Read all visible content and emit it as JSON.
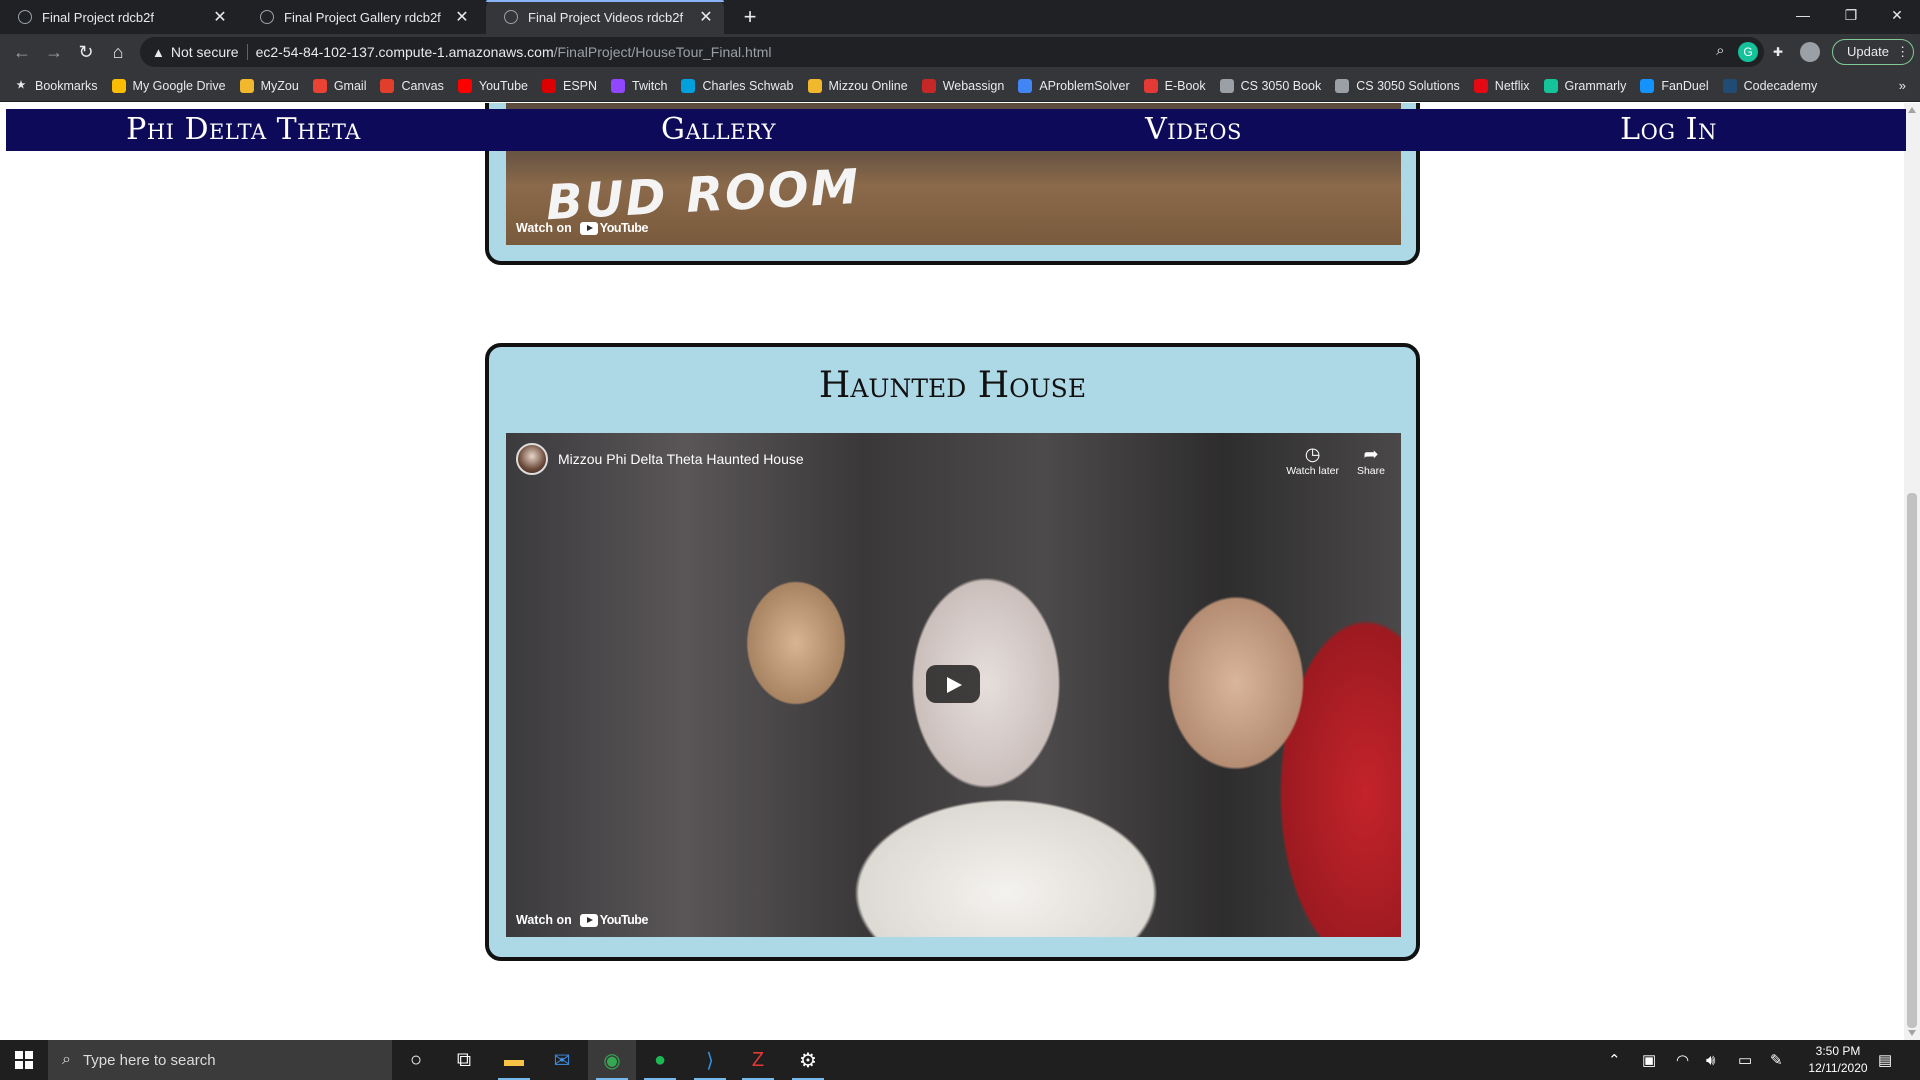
{
  "browser": {
    "tabs": [
      {
        "title": "Final Project rdcb2f",
        "active": false
      },
      {
        "title": "Final Project Gallery rdcb2f",
        "active": false
      },
      {
        "title": "Final Project Videos rdcb2f",
        "active": true
      }
    ],
    "security_label": "Not secure",
    "url_host": "ec2-54-84-102-137.compute-1.amazonaws.com",
    "url_path": "/FinalProject/HouseTour_Final.html",
    "update_label": "Update",
    "bookmarks": [
      {
        "label": "Bookmarks",
        "icon": "star-icon",
        "color": "#e8eaed"
      },
      {
        "label": "My Google Drive",
        "icon": "drive-icon",
        "color": "#fbbc04"
      },
      {
        "label": "MyZou",
        "icon": "myzou-icon",
        "color": "#f1b82d"
      },
      {
        "label": "Gmail",
        "icon": "gmail-icon",
        "color": "#ea4335"
      },
      {
        "label": "Canvas",
        "icon": "canvas-icon",
        "color": "#e13f2b"
      },
      {
        "label": "YouTube",
        "icon": "youtube-icon",
        "color": "#ff0000"
      },
      {
        "label": "ESPN",
        "icon": "espn-icon",
        "color": "#d00"
      },
      {
        "label": "Twitch",
        "icon": "twitch-icon",
        "color": "#9146ff"
      },
      {
        "label": "Charles Schwab",
        "icon": "schwab-icon",
        "color": "#00a0df"
      },
      {
        "label": "Mizzou Online",
        "icon": "mizzou-icon",
        "color": "#f1b82d"
      },
      {
        "label": "Webassign",
        "icon": "webassign-icon",
        "color": "#c62828"
      },
      {
        "label": "AProblemSolver",
        "icon": "aproblemsolver-icon",
        "color": "#4285f4"
      },
      {
        "label": "E-Book",
        "icon": "ebook-icon",
        "color": "#e53935"
      },
      {
        "label": "CS 3050 Book",
        "icon": "globe-icon",
        "color": "#9aa0a6"
      },
      {
        "label": "CS 3050 Solutions",
        "icon": "wordpress-icon",
        "color": "#9aa0a6"
      },
      {
        "label": "Netflix",
        "icon": "netflix-icon",
        "color": "#e50914"
      },
      {
        "label": "Grammarly",
        "icon": "grammarly-icon",
        "color": "#15c39a"
      },
      {
        "label": "FanDuel",
        "icon": "fanduel-icon",
        "color": "#1493ff"
      },
      {
        "label": "Codecademy",
        "icon": "codecademy-icon",
        "color": "#204b73"
      }
    ]
  },
  "site": {
    "nav": [
      "Phi Delta Theta",
      "Gallery",
      "Videos",
      "Log In"
    ],
    "video1": {
      "overlay_text": "BUD ROOM",
      "watch_on": "Watch on",
      "yt_label": "YouTube"
    },
    "video2": {
      "section_title": "Haunted House",
      "video_title": "Mizzou Phi Delta Theta Haunted House",
      "watch_later": "Watch later",
      "share": "Share",
      "watch_on": "Watch on",
      "yt_label": "YouTube"
    }
  },
  "taskbar": {
    "search_placeholder": "Type here to search",
    "time": "3:50 PM",
    "date": "12/11/2020",
    "apps": [
      "cortana-icon",
      "task-view-icon",
      "file-explorer-icon",
      "mail-icon",
      "chrome-icon",
      "spotify-icon",
      "vscode-icon",
      "filezilla-icon",
      "settings-icon"
    ]
  },
  "colors": {
    "navbar": "#0c0a59",
    "card": "#add8e6",
    "accent": "#8ab4f8"
  }
}
